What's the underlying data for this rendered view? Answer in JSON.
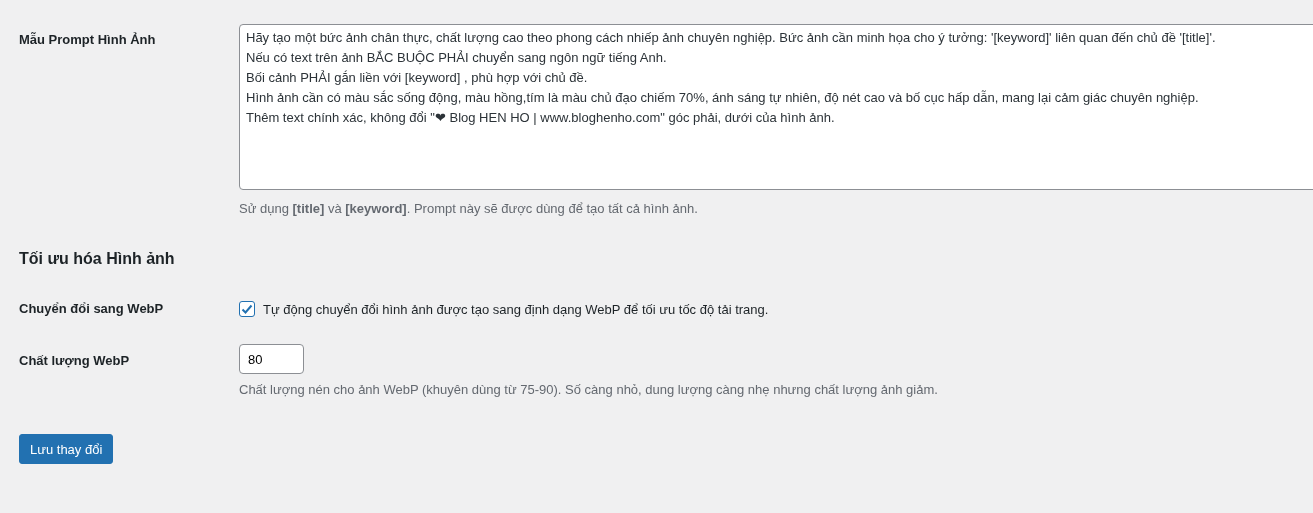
{
  "prompt_template": {
    "label": "Mẫu Prompt Hình Ảnh",
    "value": "Hãy tạo một bức ảnh chân thực, chất lượng cao theo phong cách nhiếp ảnh chuyên nghiệp. Bức ảnh cần minh họa cho ý tưởng: '[keyword]' liên quan đến chủ đề '[title]'.\nNếu có text trên ảnh BẮC BUỘC PHẢI chuyển sang ngôn ngữ tiếng Anh.\nBối cảnh PHẢI gắn liền với [keyword] , phù hợp với chủ đề.\nHình ảnh cần có màu sắc sống động, màu hồng,tím là màu chủ đạo chiếm 70%, ánh sáng tự nhiên, độ nét cao và bố cục hấp dẫn, mang lại cảm giác chuyên nghiệp.\nThêm text chính xác, không đổi \"❤ Blog HEN HO | www.bloghenho.com\" góc phải, dưới của hình ảnh.",
    "description": "Sử dụng **[title]** và **[keyword]**. Prompt này sẽ được dùng để tạo tất cả hình ảnh."
  },
  "section_title": "Tối ưu hóa Hình ảnh",
  "webp_convert": {
    "label": "Chuyển đổi sang WebP",
    "checked": true,
    "text": "Tự động chuyển đổi hình ảnh được tạo sang định dạng WebP để tối ưu tốc độ tải trang."
  },
  "webp_quality": {
    "label": "Chất lượng WebP",
    "value": "80",
    "description": "Chất lượng nén cho ảnh WebP (khuyên dùng từ 75-90). Số càng nhỏ, dung lượng càng nhẹ nhưng chất lượng ảnh giảm."
  },
  "save_button": "Lưu thay đổi"
}
